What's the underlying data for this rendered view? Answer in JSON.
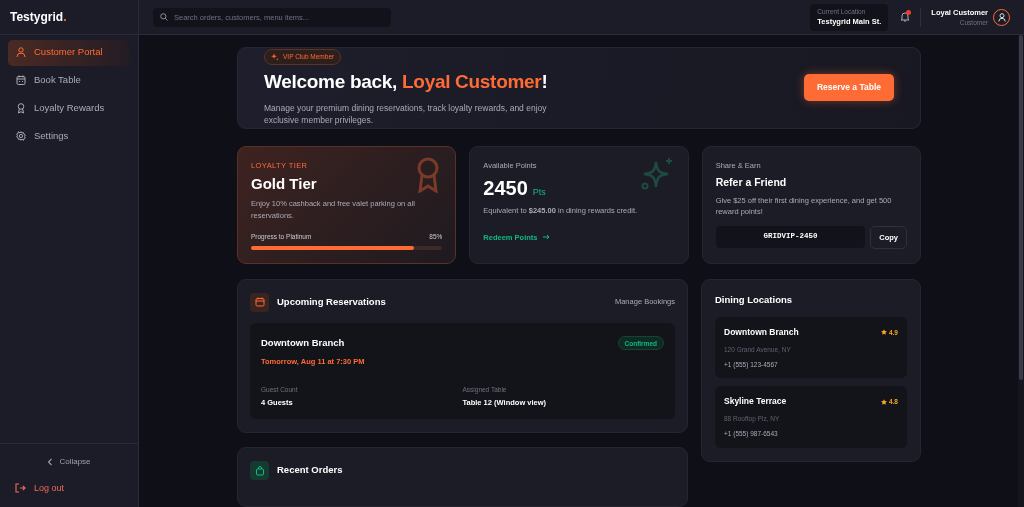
{
  "brand": {
    "name": "Testygrid",
    "mark": "."
  },
  "sidebar": {
    "items": [
      {
        "label": "Customer Portal",
        "selected": true
      },
      {
        "label": "Book Table",
        "selected": false
      },
      {
        "label": "Loyalty Rewards",
        "selected": false
      },
      {
        "label": "Settings",
        "selected": false
      }
    ],
    "collapse": "Collapse",
    "logout": "Log out"
  },
  "header": {
    "search": {
      "placeholder": "Search orders, customers, menu items..."
    },
    "location": {
      "label": "Current Location",
      "value": "Testygrid Main St."
    },
    "notifications": {
      "unread": true
    },
    "user": {
      "name": "Loyal Customer",
      "role": "Customer"
    }
  },
  "hero": {
    "badge": "VIP Club Member",
    "title": "Welcome back, ",
    "highlight": "Loyal Customer",
    "title_end": "!",
    "description": "Manage your premium dining reservations, track loyalty rewards, and enjoy exclusive member privileges.",
    "button": "Reserve a Table"
  },
  "tier": {
    "eyebrow": "LOYALTY TIER",
    "title": "Gold Tier",
    "description": "Enjoy 10% cashback and free valet parking on all reservations.",
    "progress_label": "Progress to Platinum",
    "percent": "85%",
    "level": 0.85
  },
  "points": {
    "label": "Available Points",
    "value": "2450",
    "unit": "Pts",
    "description": "Equivalent to **$245.00** in dining rewards credit.",
    "link": "Redeem Points"
  },
  "referral": {
    "eyebrow": "Share & Earn",
    "title": "Refer a Friend",
    "description": "Give $25 off their first dining experience, and get 500 reward points!",
    "code": "GRIDVIP-2450",
    "button": "Copy"
  },
  "reservations": {
    "title": "Upcoming Reservations",
    "link": "Manage Bookings",
    "items": [
      {
        "branch": "Downtown Branch",
        "when": "Tomorrow, Aug 11 at 7:30 PM",
        "status": "Confirmed",
        "fields": [
          {
            "label": "Guest Count",
            "value": "4 Guests"
          },
          {
            "label": "Assigned Table",
            "value": "Table 12 (Window view)"
          }
        ]
      }
    ]
  },
  "recent_orders": {
    "title": "Recent Orders"
  },
  "locations": {
    "title": "Dining Locations",
    "items": [
      {
        "name": "Downtown Branch",
        "rating": "4.9",
        "address": "120 Grand Avenue, NY",
        "phone": "+1 (555) 123-4567"
      },
      {
        "name": "Skyline Terrace",
        "rating": "4.8",
        "address": "88 Rooftop Plz, NY",
        "phone": "+1 (555) 987-6543"
      }
    ]
  }
}
